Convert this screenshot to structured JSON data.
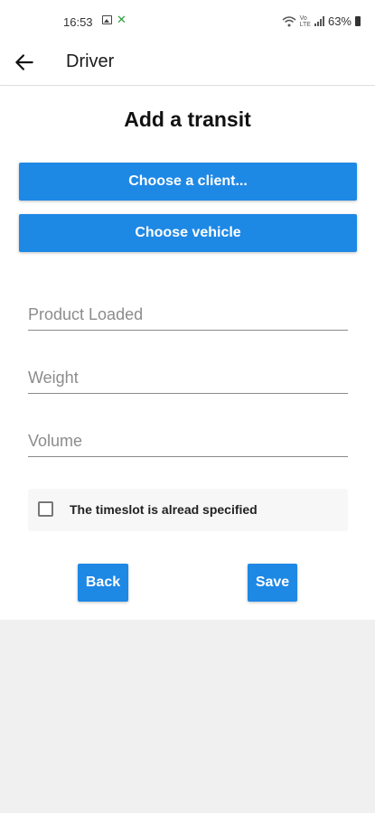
{
  "status_bar": {
    "time": "16:53",
    "battery": "63%",
    "icons": [
      "image-icon",
      "app-notification-icon",
      "wifi-icon",
      "volte-icon",
      "signal-icon",
      "battery-icon"
    ]
  },
  "app_bar": {
    "title": "Driver",
    "back_icon": "arrow-left-icon"
  },
  "form": {
    "heading": "Add a transit",
    "choose_client_label": "Choose a client...",
    "choose_vehicle_label": "Choose vehicle",
    "fields": [
      {
        "placeholder": "Product Loaded",
        "value": ""
      },
      {
        "placeholder": "Weight",
        "value": ""
      },
      {
        "placeholder": "Volume",
        "value": ""
      }
    ],
    "timeslot_checkbox": {
      "label": "The timeslot is alread specified",
      "checked": false
    },
    "back_label": "Back",
    "save_label": "Save"
  },
  "colors": {
    "accent": "#1e88e5",
    "background": "#f0f0f0",
    "card": "#ffffff"
  }
}
